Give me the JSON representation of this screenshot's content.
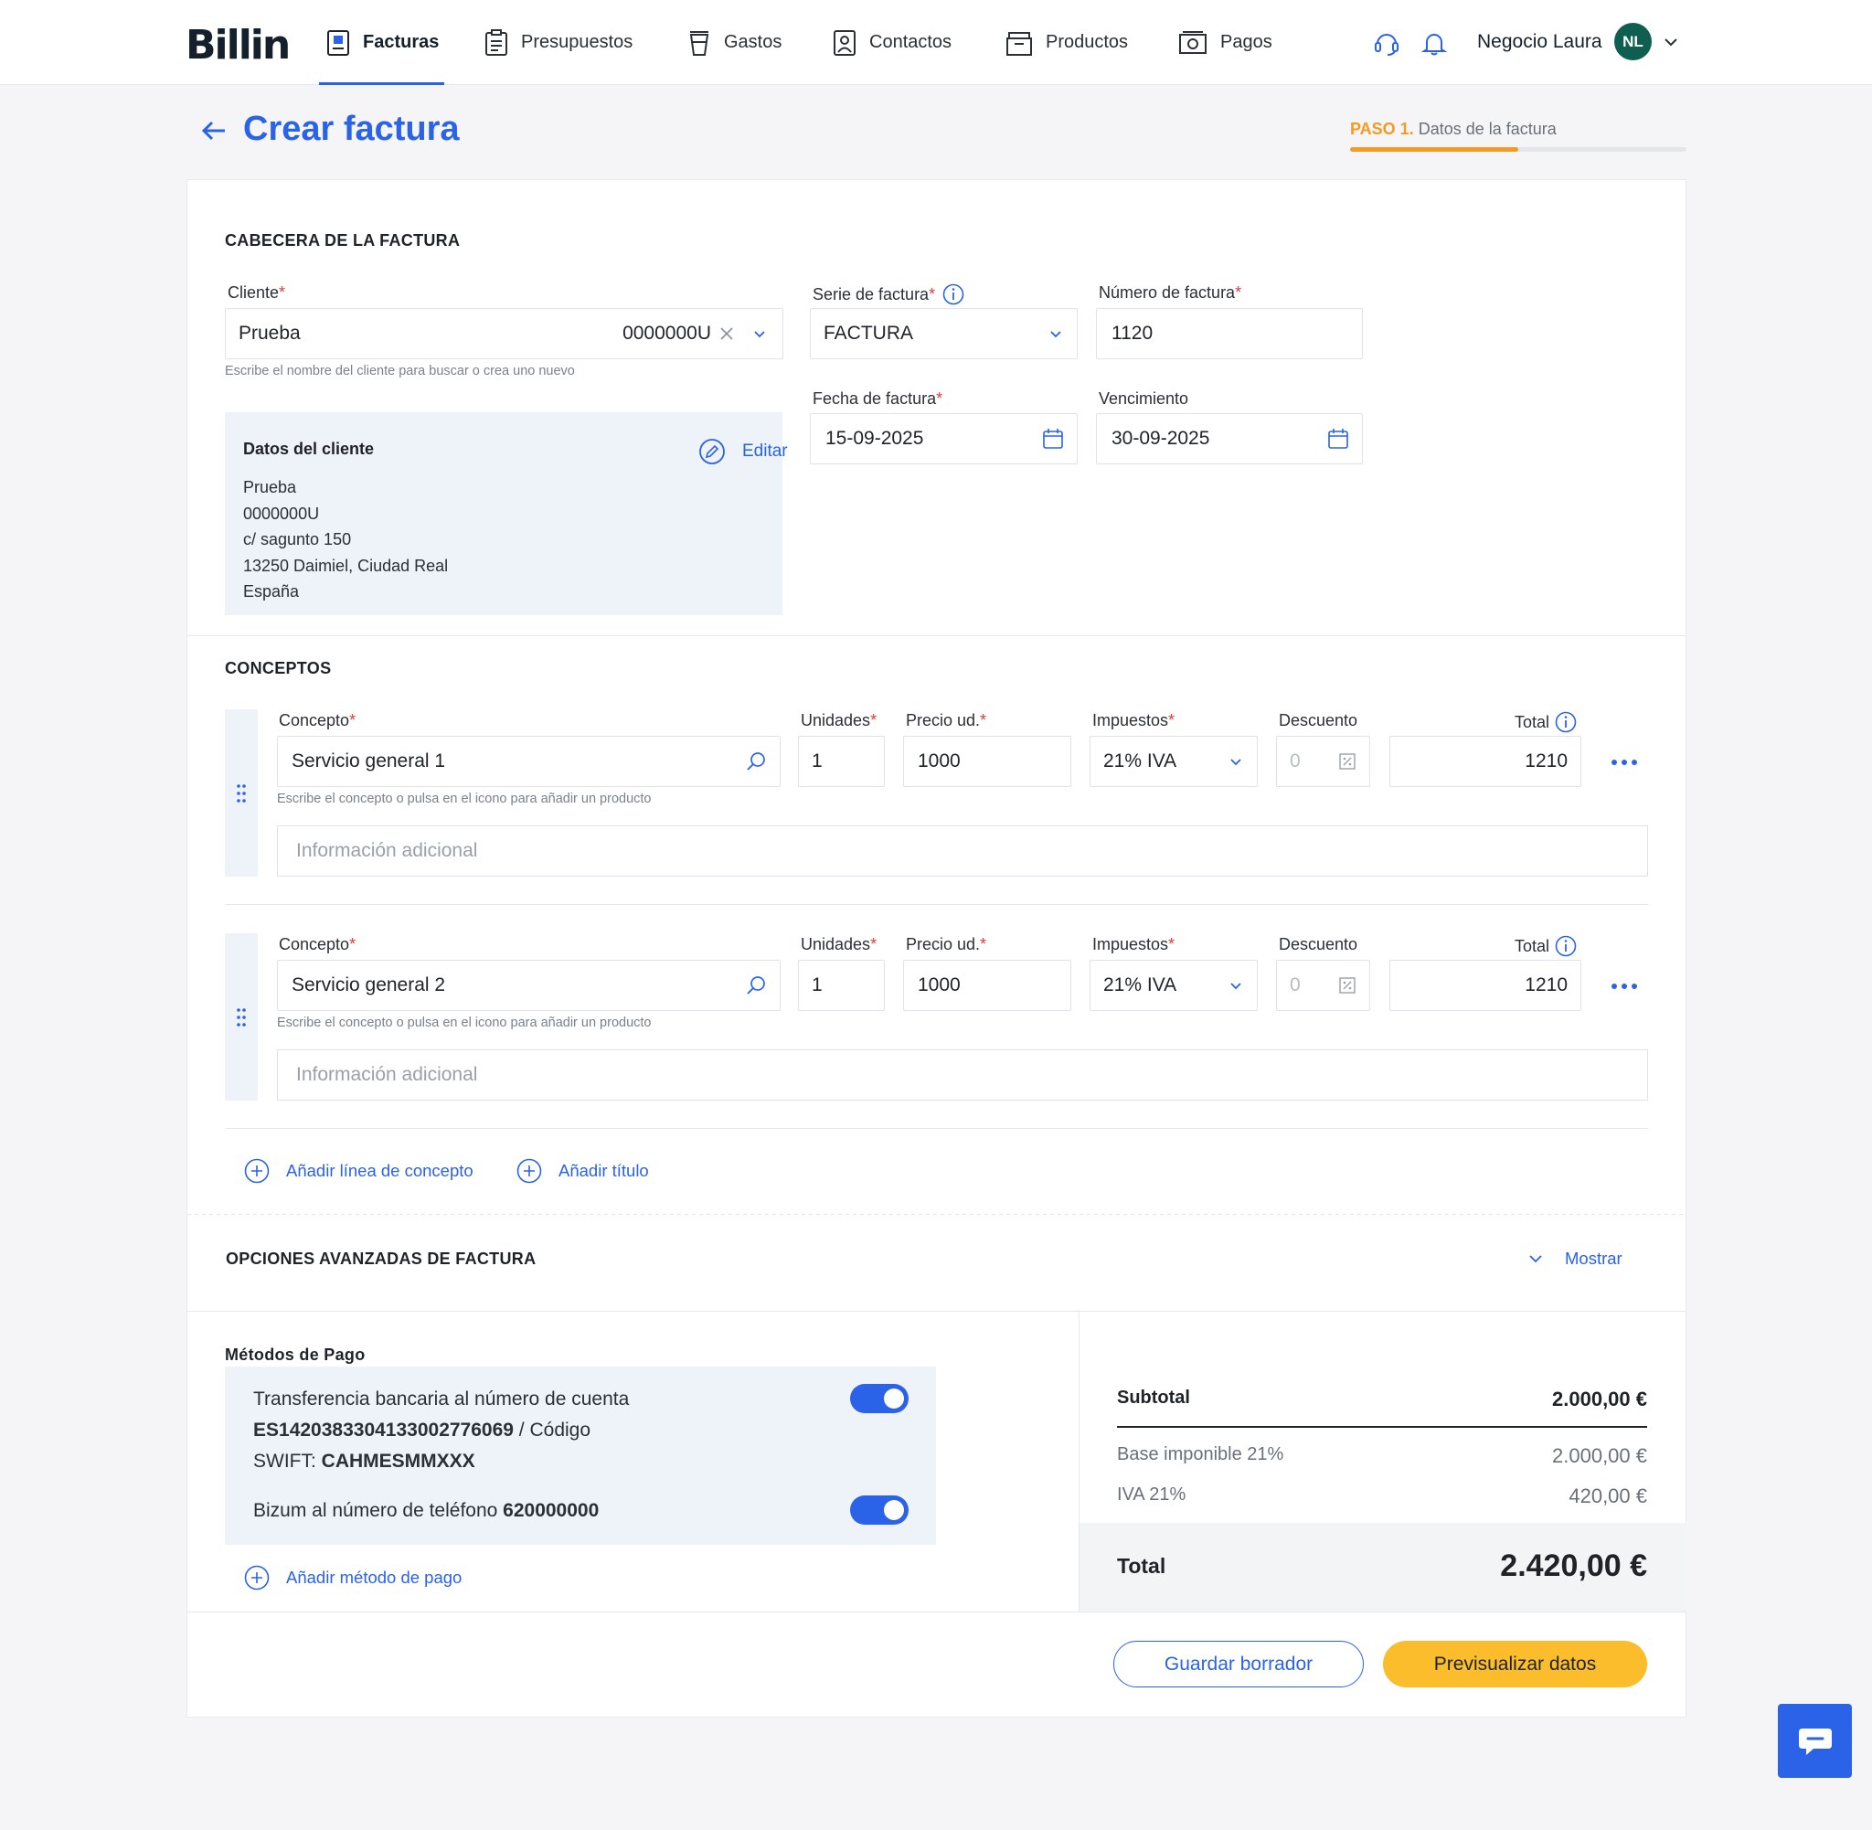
{
  "nav": {
    "logo": "Billin",
    "items": [
      {
        "label": "Facturas",
        "active": true
      },
      {
        "label": "Presupuestos"
      },
      {
        "label": "Gastos"
      },
      {
        "label": "Contactos"
      },
      {
        "label": "Productos"
      },
      {
        "label": "Pagos"
      }
    ],
    "user_name": "Negocio Laura",
    "avatar_initials": "NL"
  },
  "page": {
    "title": "Crear factura",
    "step_prefix": "PASO 1.",
    "step_label": "Datos de la factura",
    "step_progress": 0.5
  },
  "header_section": {
    "title": "CABECERA DE LA FACTURA",
    "client_label": "Cliente",
    "client_name": "Prueba",
    "client_id": "0000000U",
    "client_hint": "Escribe el nombre del cliente para buscar o crea uno nuevo",
    "series_label": "Serie de factura",
    "series_value": "FACTURA",
    "number_label": "Número de factura",
    "number_value": "1120",
    "date_label": "Fecha de factura",
    "date_value": "15-09-2025",
    "due_label": "Vencimiento",
    "due_value": "30-09-2025",
    "client_box": {
      "title": "Datos del cliente",
      "edit_label": "Editar",
      "lines": [
        "Prueba",
        "0000000U",
        "c/ sagunto 150",
        "13250 Daimiel, Ciudad Real",
        "España"
      ]
    }
  },
  "concepts": {
    "title": "CONCEPTOS",
    "labels": {
      "concept": "Concepto",
      "units": "Unidades",
      "price": "Precio ud.",
      "taxes": "Impuestos",
      "discount": "Descuento",
      "total": "Total"
    },
    "hint": "Escribe el concepto o pulsa en el icono para añadir un producto",
    "info_placeholder": "Información adicional",
    "lines": [
      {
        "concept": "Servicio general 1",
        "units": "1",
        "price": "1000",
        "tax": "21% IVA",
        "discount": "0",
        "total": "1210"
      },
      {
        "concept": "Servicio general 2",
        "units": "1",
        "price": "1000",
        "tax": "21% IVA",
        "discount": "0",
        "total": "1210"
      }
    ],
    "add_line_label": "Añadir línea de concepto",
    "add_title_label": "Añadir título"
  },
  "advanced": {
    "title": "OPCIONES AVANZADAS DE FACTURA",
    "toggle_label": "Mostrar"
  },
  "payment": {
    "title": "Métodos de Pago",
    "transfer": {
      "line1": "Transferencia bancaria al número de cuenta",
      "iban": "ES1420383304133002776069",
      "code_text": " / Código",
      "swift_prefix": "SWIFT: ",
      "swift": "CAHMESMMXXX",
      "enabled": true
    },
    "bizum": {
      "prefix": "Bizum al número de teléfono ",
      "phone": "620000000",
      "enabled": true
    },
    "add_label": "Añadir método de pago"
  },
  "totals": {
    "subtotal_label": "Subtotal",
    "subtotal_value": "2.000,00 €",
    "base_label": "Base imponible 21%",
    "base_value": "2.000,00 €",
    "iva_label": "IVA 21%",
    "iva_value": "420,00 €",
    "total_label": "Total",
    "total_value": "2.420,00 €"
  },
  "actions": {
    "save_draft": "Guardar borrador",
    "preview": "Previsualizar datos"
  },
  "colors": {
    "primary": "#2a62e8",
    "accent": "#f59a23",
    "button_yellow": "#fbbd2b",
    "avatar": "#0f5f50"
  }
}
